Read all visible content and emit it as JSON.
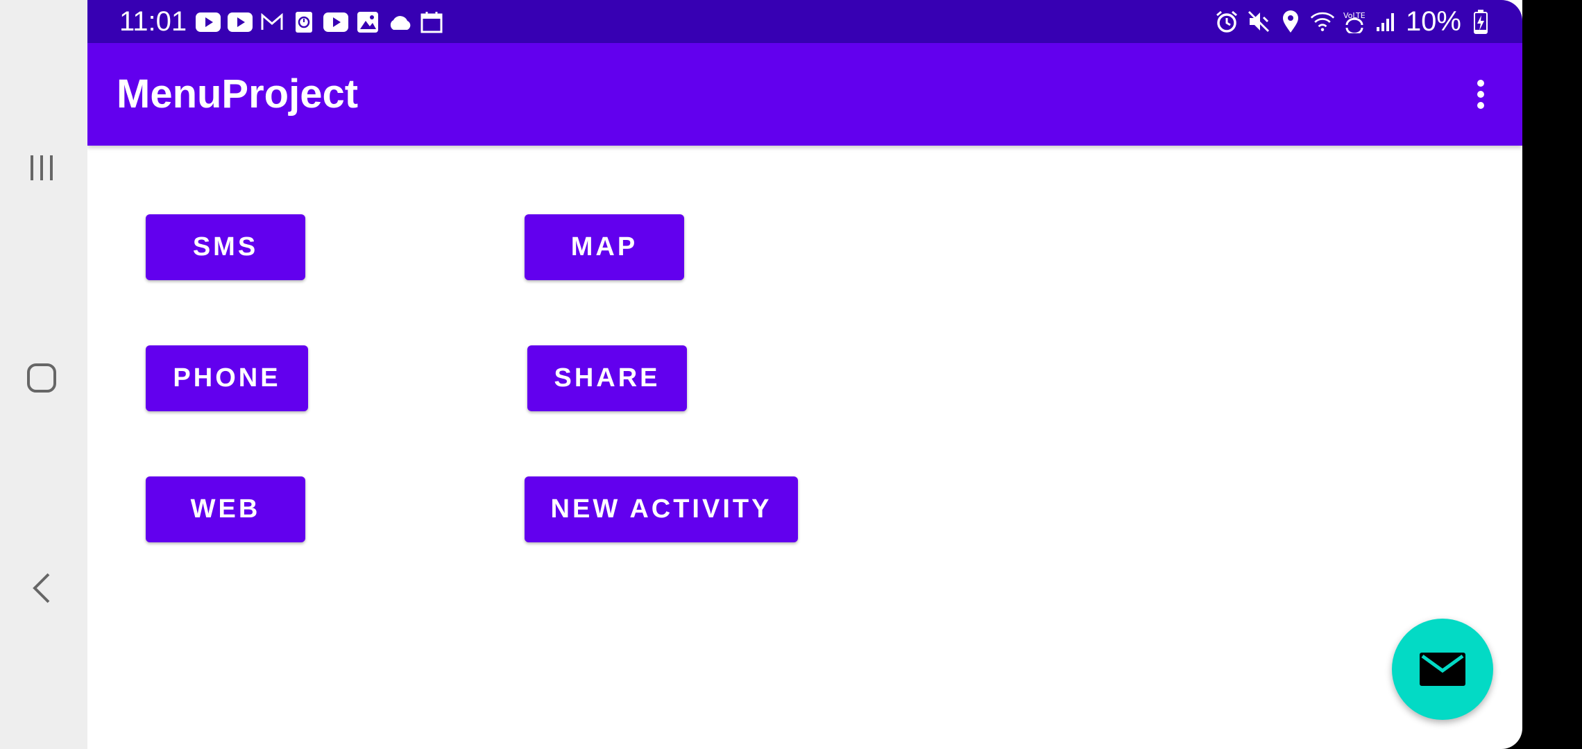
{
  "status_bar": {
    "time": "11:01",
    "left_icons": [
      "youtube-icon",
      "youtube-icon",
      "gmail-icon",
      "calendar-clock-icon",
      "youtube-icon",
      "gallery-icon",
      "cloud-icon",
      "calendar-icon"
    ],
    "right_icons": [
      "alarm-icon",
      "mute-icon",
      "location-icon",
      "wifi-icon",
      "volte-icon",
      "signal-icon"
    ],
    "battery": "10%",
    "background_color": "#3700b3"
  },
  "app_bar": {
    "title": "MenuProject",
    "background_color": "#6200ee"
  },
  "buttons": {
    "sms": "SMS",
    "map": "MAP",
    "phone": "PHONE",
    "share": "SHARE",
    "web": "WEB",
    "new_activity": "NEW ACTIVITY"
  },
  "fab": {
    "icon": "mail-icon",
    "color": "#03dac5"
  },
  "nav_bar": {
    "items": [
      "recents-icon",
      "home-icon",
      "back-icon"
    ]
  }
}
